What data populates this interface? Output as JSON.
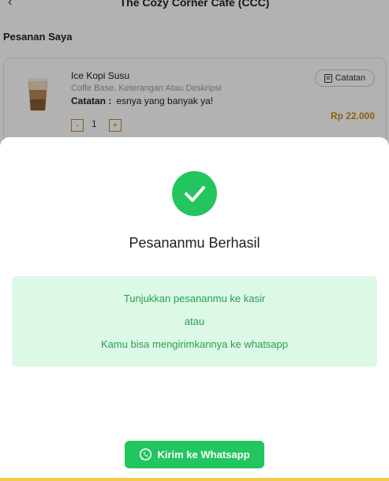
{
  "header": {
    "back_icon": "arrow-left-icon",
    "title": "The Cozy Corner Cafe (CCC)"
  },
  "orders": {
    "section_title": "Pesanan Saya",
    "items": [
      {
        "name": "Ice Kopi Susu",
        "description": "Coffe Base. Keterangan Atau Deskripsi",
        "note_label": "Catatan :",
        "note_text": "esnya yang banyak ya!",
        "note_button": "Catatan",
        "quantity": "1",
        "minus": "-",
        "plus": "+",
        "price": "Rp 22.000"
      }
    ]
  },
  "success_modal": {
    "icon": "check-circle-icon",
    "title": "Pesananmu Berhasil",
    "info_lines": [
      "Tunjukkan pesananmu ke kasir",
      "atau",
      "Kamu bisa mengirimkannya ke whatsapp"
    ],
    "whatsapp_button": "Kirim ke Whatsapp"
  },
  "colors": {
    "accent_green": "#22c55e",
    "info_bg": "#dcf8e6",
    "info_text": "#2a9d52",
    "price_gold": "#c78a17"
  }
}
